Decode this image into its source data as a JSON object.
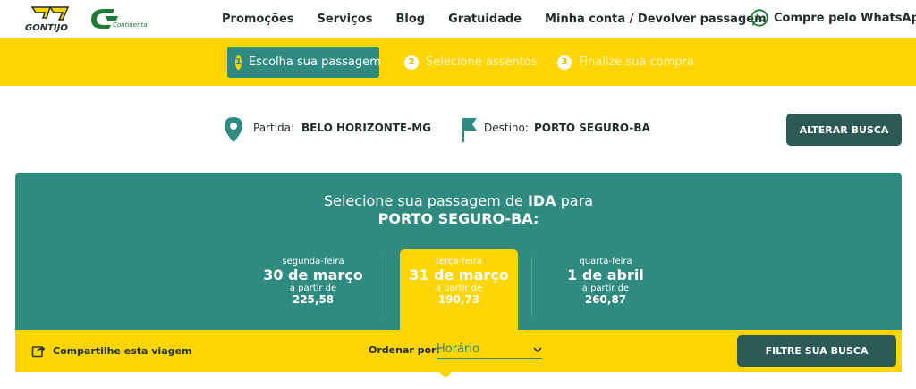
{
  "header": {
    "brand_gontijo": "GONTIJO",
    "brand_continental": "Continental",
    "nav": [
      "Promoções",
      "Serviços",
      "Blog",
      "Gratuidade",
      "Minha conta / Devolver passagem"
    ],
    "whatsapp_label": "Compre pelo WhatsApp"
  },
  "steps": [
    {
      "num": "1",
      "label": "Escolha sua passagem"
    },
    {
      "num": "2",
      "label": "Selecione assentos"
    },
    {
      "num": "3",
      "label": "Finalize sua compra"
    }
  ],
  "route": {
    "origin_label": "Partida:",
    "origin_value": "BELO HORIZONTE-MG",
    "destination_label": "Destino:",
    "destination_value": "PORTO SEGURO-BA",
    "change_button": "ALTERAR BUSCA"
  },
  "panel": {
    "title_prefix": "Selecione sua passagem de ",
    "title_bold": "IDA",
    "title_suffix": " para",
    "title_destination": "PORTO SEGURO-BA:"
  },
  "days": [
    {
      "weekday": "segunda-feira",
      "date": "30 de março",
      "from": "a partir de",
      "price": "225,58"
    },
    {
      "weekday": "terça-feira",
      "date": "31 de março",
      "from": "a partir de",
      "price": "190,73"
    },
    {
      "weekday": "quarta-feira",
      "date": "1 de abril",
      "from": "a partir de",
      "price": "260,87"
    }
  ],
  "bottom": {
    "share_label": "Compartilhe esta viagem",
    "sort_label": "Ordenar por:",
    "sort_value": "Horário",
    "filter_button": "FILTRE SUA BUSCA"
  },
  "colors": {
    "yellow": "#ffd500",
    "teal": "#2f8a80",
    "dark_teal": "#2d5a56",
    "whatsapp_green": "#25d366"
  }
}
